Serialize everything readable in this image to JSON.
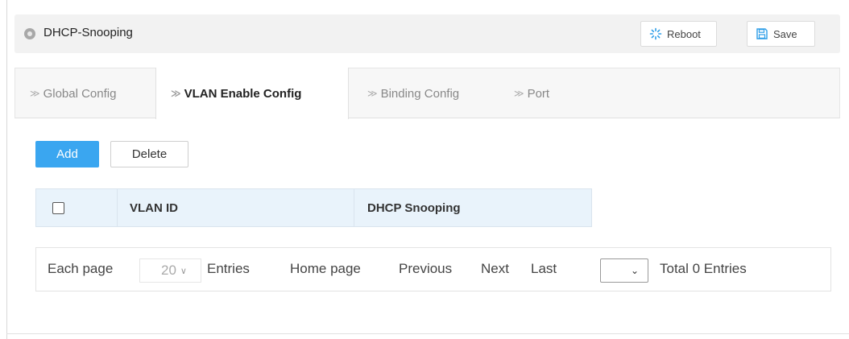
{
  "header": {
    "title": "DHCP-Snooping",
    "reboot_label": "Reboot",
    "save_label": "Save"
  },
  "tabs": [
    {
      "label": "Global Config",
      "active": false
    },
    {
      "label": "VLAN Enable Config",
      "active": true
    },
    {
      "label": "Binding Config",
      "active": false
    },
    {
      "label": "Port",
      "active": false
    }
  ],
  "actions": {
    "add_label": "Add",
    "delete_label": "Delete"
  },
  "table": {
    "columns": [
      "VLAN ID",
      "DHCP Snooping"
    ],
    "rows": []
  },
  "pager": {
    "each_page_label": "Each page",
    "page_size": "20",
    "entries_label": "Entries",
    "home_label": "Home page",
    "previous_label": "Previous",
    "next_label": "Next",
    "last_label": "Last",
    "jump_value": "",
    "total_label": "Total 0 Entries"
  },
  "colors": {
    "accent": "#3aa6f0",
    "reboot_icon": "#2e9ee8",
    "header_bg": "#e9f3fb"
  },
  "icons": {
    "header": "circle-dot-icon",
    "reboot": "spinner-icon",
    "save": "floppy-disk-icon",
    "tab_arrow": "double-chevron-right-icon",
    "dropdown": "chevron-down-icon"
  }
}
